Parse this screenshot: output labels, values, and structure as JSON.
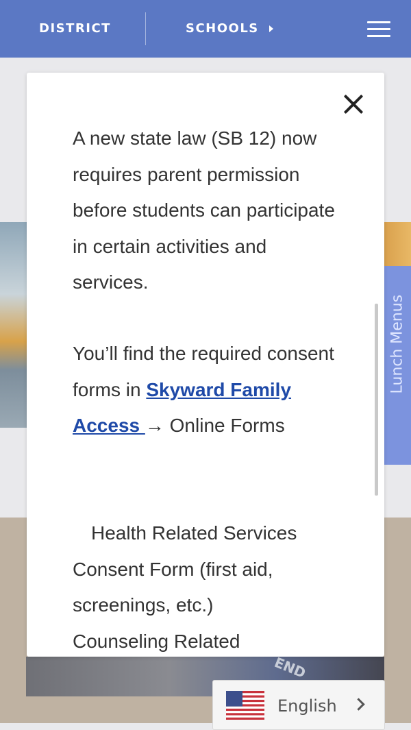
{
  "nav": {
    "district_label": "DISTRICT",
    "schools_label": "SCHOOLS"
  },
  "background": {
    "lunch_tab_label": "Lunch Menus",
    "photo_text": "END"
  },
  "modal": {
    "paragraph1": "A new state law (SB 12) now requires parent permission before students can participate in certain activities and services.",
    "paragraph2_before": "You’ll find the required consent forms in ",
    "paragraph2_link": "Skyward Family Access ",
    "paragraph2_after": "→ Online Forms",
    "item1": "Health Related Services Consent Form (first aid, screenings, etc.)",
    "item2_glyph": "",
    "item2": "Counseling Related"
  },
  "language": {
    "label": "English"
  },
  "colors": {
    "nav_bg": "#5b78c4",
    "link": "#1f4aa8",
    "lunch_tab": "#7c93de"
  },
  "icons": [
    "hamburger-menu-icon",
    "close-icon",
    "us-flag-icon",
    "chevron-right-icon",
    "caret-right-icon"
  ]
}
